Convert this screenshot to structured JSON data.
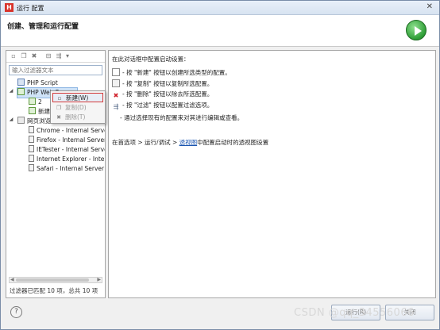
{
  "window": {
    "title": "运行 配置",
    "app_icon": "H"
  },
  "header": {
    "title": "创建、管理和运行配置"
  },
  "filter": {
    "placeholder": "输入过滤器文本"
  },
  "tree": {
    "php_script": "PHP Script",
    "php_web_page": "PHP Web Page",
    "child_2": "2",
    "child_new": "新建",
    "web_browser": "网页浏览器",
    "browsers": [
      "Chrome - Internal Serve",
      "Firefox - Internal Server",
      "IETester - Internal Serve",
      "Internet Explorer - Inter",
      "Safari - Internal Server"
    ]
  },
  "context_menu": {
    "new": "新建(W)",
    "copy": "复制(D)",
    "delete": "删除(T)"
  },
  "status": "过滤器已匹配 10 项，总共 10 项",
  "right": {
    "intro": "在此对话框中配置启动设置：",
    "items": [
      "- 按 \"新建\" 按钮以创建所选类型的配置。",
      "- 按 \"复制\" 按钮以复制所选配置。",
      "- 按 \"删除\" 按钮以除去所选配置。",
      "- 按 \"过滤\" 按钮以配置过滤选项。",
      "- 通过选择现有的配置来对其进行编辑或查看。"
    ],
    "prefs_prefix": "在首选项 > 运行/调试 > ",
    "prefs_link": "透视图",
    "prefs_suffix": "中配置启动时的透视图设置"
  },
  "buttons": {
    "run": "运行(R)",
    "close": "关闭"
  },
  "help": "?",
  "watermark": "CSDN @qq_34556066"
}
